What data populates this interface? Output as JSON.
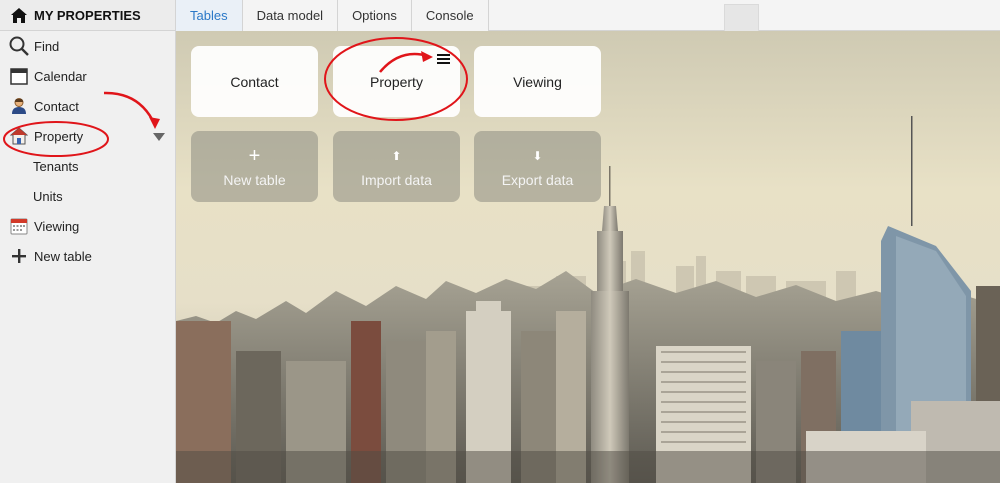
{
  "sidebar": {
    "header": {
      "label": "MY PROPERTIES",
      "icon": "home-icon"
    },
    "items": [
      {
        "label": "Find",
        "icon": "search-icon"
      },
      {
        "label": "Calendar",
        "icon": "calendar-icon"
      },
      {
        "label": "Contact",
        "icon": "person-icon"
      },
      {
        "label": "Property",
        "icon": "house-icon"
      },
      {
        "label": "Tenants"
      },
      {
        "label": "Units"
      },
      {
        "label": "Viewing",
        "icon": "calendar-grid-icon"
      },
      {
        "label": "New table",
        "icon": "plus-icon"
      }
    ]
  },
  "tabs": [
    {
      "label": "Tables",
      "active": true
    },
    {
      "label": "Data model"
    },
    {
      "label": "Options"
    },
    {
      "label": "Console"
    }
  ],
  "tables": [
    {
      "label": "Contact"
    },
    {
      "label": "Property"
    },
    {
      "label": "Viewing"
    }
  ],
  "actions": [
    {
      "label": "New table",
      "icon": "+"
    },
    {
      "label": "Import data",
      "icon": "⬆"
    },
    {
      "label": "Export data",
      "icon": "⬇"
    }
  ],
  "colors": {
    "accent": "#2b78c7",
    "annotation": "#e0151a"
  }
}
